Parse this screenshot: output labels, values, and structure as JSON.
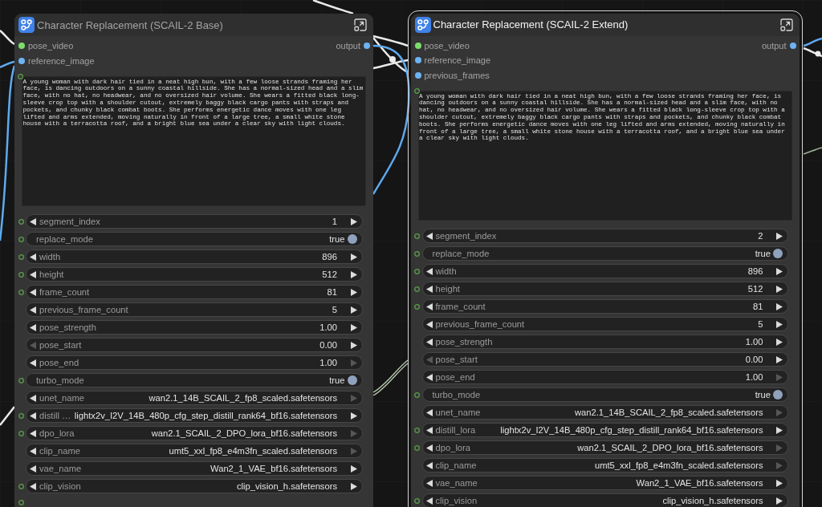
{
  "nodes": [
    {
      "title": "Character Replacement (SCAIL-2 Base)",
      "selected": false,
      "footer_socket": true,
      "inputs": [
        {
          "label": "pose_video",
          "color": "#7cdc6a"
        },
        {
          "label": "reference_image",
          "color": "#6cb4f2"
        }
      ],
      "outputs": [
        {
          "label": "output",
          "color": "#6cb4f2"
        }
      ],
      "prompt": "A young woman with dark hair tied in a neat high bun, with a few loose strands framing her face, is dancing outdoors on a sunny coastal hillside. She has a normal-sized head and a slim face, with no hat, no headwear, and no oversized hair volume. She wears a fitted black long-sleeve crop top with a shoulder cutout, extremely baggy black cargo pants with straps and pockets, and chunky black combat boots. She performs energetic dance moves with one leg lifted and arms extended, moving naturally in front of a large tree, a small white stone house with a terracotta roof, and a bright blue sea under a clear sky with light clouds.",
      "widgets": [
        {
          "kind": "number",
          "label": "segment_index",
          "value": "1",
          "socket": true,
          "prev_disabled": false,
          "next_disabled": false
        },
        {
          "kind": "toggle",
          "label": "replace_mode",
          "value": "true",
          "on": true,
          "socket": true
        },
        {
          "kind": "number",
          "label": "width",
          "value": "896",
          "socket": true,
          "prev_disabled": false,
          "next_disabled": false
        },
        {
          "kind": "number",
          "label": "height",
          "value": "512",
          "socket": true,
          "prev_disabled": false,
          "next_disabled": false
        },
        {
          "kind": "number",
          "label": "frame_count",
          "value": "81",
          "socket": true,
          "prev_disabled": false,
          "next_disabled": false
        },
        {
          "kind": "number",
          "label": "previous_frame_count",
          "value": "5",
          "socket": false,
          "prev_disabled": false,
          "next_disabled": false
        },
        {
          "kind": "number",
          "label": "pose_strength",
          "value": "1.00",
          "socket": false,
          "prev_disabled": false,
          "next_disabled": false
        },
        {
          "kind": "number",
          "label": "pose_start",
          "value": "0.00",
          "socket": false,
          "prev_disabled": true,
          "next_disabled": false
        },
        {
          "kind": "number",
          "label": "pose_end",
          "value": "1.00",
          "socket": false,
          "prev_disabled": false,
          "next_disabled": true
        },
        {
          "kind": "toggle",
          "label": "turbo_mode",
          "value": "true",
          "on": true,
          "socket": true
        },
        {
          "kind": "combo",
          "label": "unet_name",
          "value": "wan2.1_14B_SCAIL_2_fp8_scaled.safetensors",
          "socket": false,
          "prev_disabled": false,
          "next_disabled": true
        },
        {
          "kind": "combo",
          "label": "distill …",
          "value": "lightx2v_I2V_14B_480p_cfg_step_distill_rank64_bf16.safetensors",
          "socket": true,
          "prev_disabled": false,
          "next_disabled": false
        },
        {
          "kind": "combo",
          "label": "dpo_lora",
          "value": "wan2.1_SCAIL_2_DPO_lora_bf16.safetensors",
          "socket": true,
          "prev_disabled": false,
          "next_disabled": true
        },
        {
          "kind": "combo",
          "label": "clip_name",
          "value": "umt5_xxl_fp8_e4m3fn_scaled.safetensors",
          "socket": false,
          "prev_disabled": false,
          "next_disabled": true
        },
        {
          "kind": "combo",
          "label": "vae_name",
          "value": "Wan2_1_VAE_bf16.safetensors",
          "socket": false,
          "prev_disabled": false,
          "next_disabled": false
        },
        {
          "kind": "combo",
          "label": "clip_vision",
          "value": "clip_vision_h.safetensors",
          "socket": true,
          "prev_disabled": false,
          "next_disabled": false
        }
      ]
    },
    {
      "title": "Character Replacement (SCAIL-2 Extend)",
      "selected": true,
      "footer_socket": false,
      "inputs": [
        {
          "label": "pose_video",
          "color": "#7cdc6a"
        },
        {
          "label": "reference_image",
          "color": "#6cb4f2"
        },
        {
          "label": "previous_frames",
          "color": "#6cb4f2"
        }
      ],
      "outputs": [
        {
          "label": "output",
          "color": "#6cb4f2"
        }
      ],
      "prompt": "A young woman with dark hair tied in a neat high bun, with a few loose strands framing her face, is dancing outdoors on a sunny coastal hillside. She has a normal-sized head and a slim face, with no hat, no headwear, and no oversized hair volume. She wears a fitted black long-sleeve crop top with a shoulder cutout, extremely baggy black cargo pants with straps and pockets, and chunky black combat boots. She performs energetic dance moves with one leg lifted and arms extended, moving naturally in front of a large tree, a small white stone house with a terracotta roof, and a bright blue sea under a clear sky with light clouds.",
      "widgets": [
        {
          "kind": "number",
          "label": "segment_index",
          "value": "2",
          "socket": true,
          "prev_disabled": false,
          "next_disabled": false
        },
        {
          "kind": "toggle",
          "label": "replace_mode",
          "value": "true",
          "on": true,
          "socket": true
        },
        {
          "kind": "number",
          "label": "width",
          "value": "896",
          "socket": true,
          "prev_disabled": false,
          "next_disabled": false
        },
        {
          "kind": "number",
          "label": "height",
          "value": "512",
          "socket": true,
          "prev_disabled": false,
          "next_disabled": false
        },
        {
          "kind": "number",
          "label": "frame_count",
          "value": "81",
          "socket": true,
          "prev_disabled": false,
          "next_disabled": false
        },
        {
          "kind": "number",
          "label": "previous_frame_count",
          "value": "5",
          "socket": false,
          "prev_disabled": false,
          "next_disabled": false
        },
        {
          "kind": "number",
          "label": "pose_strength",
          "value": "1.00",
          "socket": false,
          "prev_disabled": false,
          "next_disabled": false
        },
        {
          "kind": "number",
          "label": "pose_start",
          "value": "0.00",
          "socket": false,
          "prev_disabled": true,
          "next_disabled": false
        },
        {
          "kind": "number",
          "label": "pose_end",
          "value": "1.00",
          "socket": false,
          "prev_disabled": false,
          "next_disabled": true
        },
        {
          "kind": "toggle",
          "label": "turbo_mode",
          "value": "true",
          "on": true,
          "socket": true
        },
        {
          "kind": "combo",
          "label": "unet_name",
          "value": "wan2.1_14B_SCAIL_2_fp8_scaled.safetensors",
          "socket": false,
          "prev_disabled": false,
          "next_disabled": true
        },
        {
          "kind": "combo",
          "label": "distill_lora",
          "value": "lightx2v_I2V_14B_480p_cfg_step_distill_rank64_bf16.safetensors",
          "socket": true,
          "prev_disabled": false,
          "next_disabled": false
        },
        {
          "kind": "combo",
          "label": "dpo_lora",
          "value": "wan2.1_SCAIL_2_DPO_lora_bf16.safetensors",
          "socket": true,
          "prev_disabled": false,
          "next_disabled": true
        },
        {
          "kind": "combo",
          "label": "clip_name",
          "value": "umt5_xxl_fp8_e4m3fn_scaled.safetensors",
          "socket": false,
          "prev_disabled": false,
          "next_disabled": true
        },
        {
          "kind": "combo",
          "label": "vae_name",
          "value": "Wan2_1_VAE_bf16.safetensors",
          "socket": false,
          "prev_disabled": false,
          "next_disabled": false
        },
        {
          "kind": "combo",
          "label": "clip_vision",
          "value": "clip_vision_h.safetensors",
          "socket": true,
          "prev_disabled": false,
          "next_disabled": false
        }
      ]
    }
  ]
}
